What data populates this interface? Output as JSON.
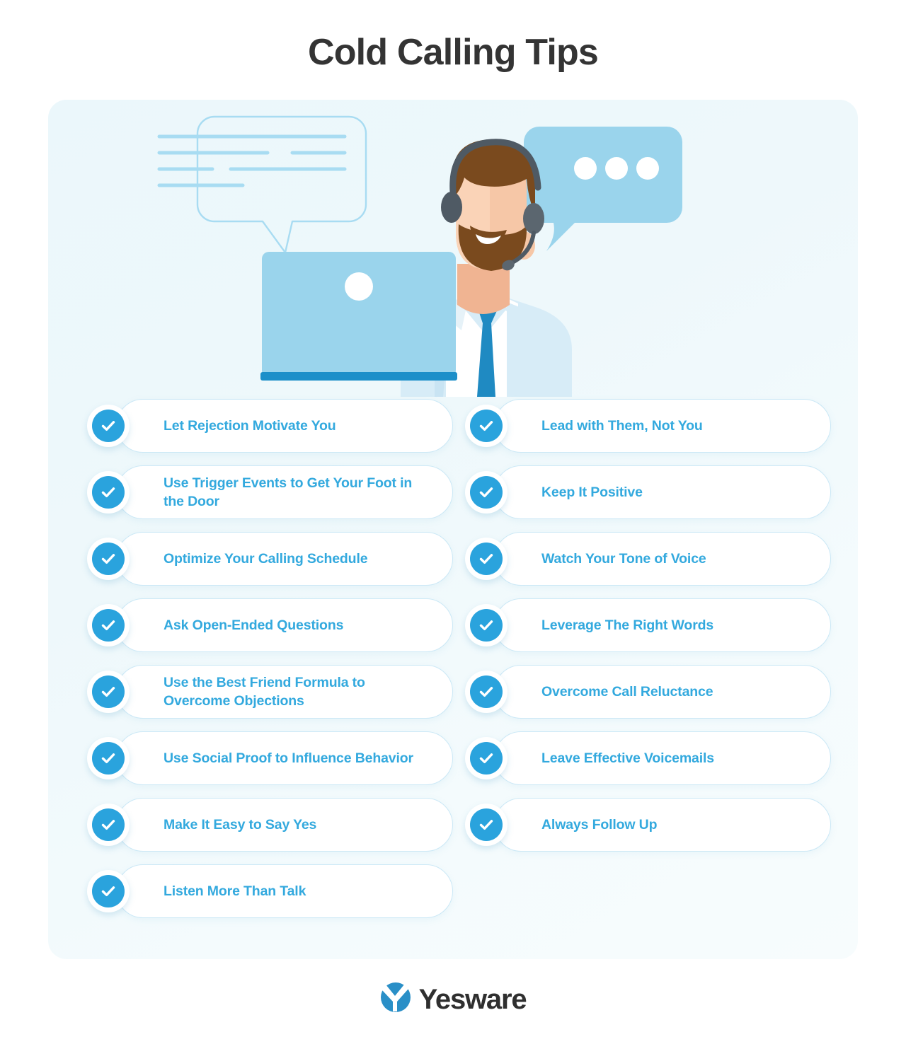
{
  "title": "Cold Calling Tips",
  "colors": {
    "title_text": "#343434",
    "panel_background": "#eef8fb",
    "pill_background": "#ffffff",
    "pill_border": "#cbe8f6",
    "tip_text": "#33a9de",
    "check_circle": "#2aa3dd",
    "check_mark": "#ffffff",
    "illustration_blue": "#9ad4ec",
    "illustration_blue_dark": "#1c8fc9",
    "hair_brown": "#7a4a1e",
    "skin": "#f6c7a7",
    "headset_gray": "#4f5a64",
    "logo_blue": "#2a8fc7",
    "logo_text": "#2f2f2f"
  },
  "illustration": {
    "left_bubble": {
      "name": "outlined-speech-bubble",
      "style": "outline",
      "line_rows": 4
    },
    "right_bubble": {
      "name": "filled-speech-bubble",
      "style": "filled",
      "dots": 3
    },
    "character": {
      "name": "sales-rep-with-headset",
      "has_headset": true,
      "has_beard": true
    },
    "laptop": {
      "name": "laptop",
      "has_logo_dot": true
    }
  },
  "tips": {
    "left_column": [
      {
        "label": "Let Rejection Motivate You"
      },
      {
        "label": "Use Trigger Events to Get Your Foot in the Door"
      },
      {
        "label": "Optimize Your Calling Schedule"
      },
      {
        "label": "Ask Open-Ended Questions"
      },
      {
        "label": "Use the Best Friend Formula to Overcome Objections"
      },
      {
        "label": "Use Social Proof to Influence Behavior"
      },
      {
        "label": "Make It Easy to Say Yes"
      },
      {
        "label": "Listen More Than Talk"
      }
    ],
    "right_column": [
      {
        "label": "Lead with Them, Not You"
      },
      {
        "label": "Keep It Positive"
      },
      {
        "label": "Watch Your Tone of Voice"
      },
      {
        "label": "Leverage The Right Words"
      },
      {
        "label": "Overcome Call Reluctance"
      },
      {
        "label": "Leave Effective Voicemails"
      },
      {
        "label": "Always Follow Up"
      }
    ]
  },
  "footer": {
    "brand": "Yesware",
    "logo_icon": "yesware-y-mark-icon"
  }
}
